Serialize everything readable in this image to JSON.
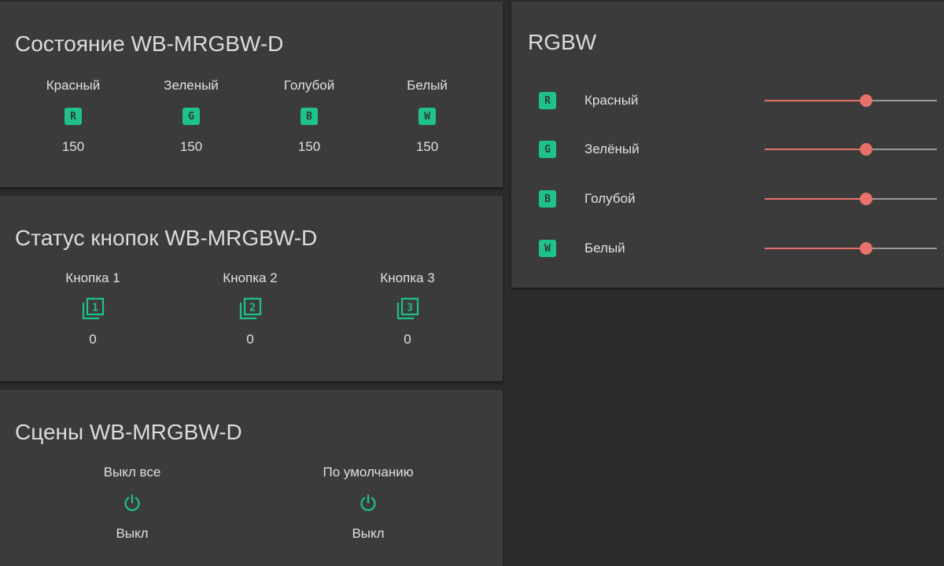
{
  "colors": {
    "background": "#2b2b2b",
    "card": "#3b3b3b",
    "accent": "#1ec28a",
    "slider": "#e8716b",
    "track": "#9a9a9a"
  },
  "state_card": {
    "title": "Состояние WB-MRGBW-D",
    "channels": [
      {
        "label": "Красный",
        "icon": "R",
        "icon_name": "red-channel-icon",
        "value": "150"
      },
      {
        "label": "Зеленый",
        "icon": "G",
        "icon_name": "green-channel-icon",
        "value": "150"
      },
      {
        "label": "Голубой",
        "icon": "B",
        "icon_name": "blue-channel-icon",
        "value": "150"
      },
      {
        "label": "Белый",
        "icon": "W",
        "icon_name": "white-channel-icon",
        "value": "150"
      }
    ]
  },
  "buttons_card": {
    "title": "Статус кнопок WB-MRGBW-D",
    "buttons": [
      {
        "label": "Кнопка 1",
        "icon": "1",
        "icon_name": "filter-1-icon",
        "value": "0"
      },
      {
        "label": "Кнопка 2",
        "icon": "2",
        "icon_name": "filter-2-icon",
        "value": "0"
      },
      {
        "label": "Кнопка 3",
        "icon": "3",
        "icon_name": "filter-3-icon",
        "value": "0"
      }
    ]
  },
  "scenes_card": {
    "title": "Сцены WB-MRGBW-D",
    "scenes": [
      {
        "label": "Выкл все",
        "icon_name": "power-icon",
        "value": "Выкл"
      },
      {
        "label": "По умолчанию",
        "icon_name": "power-icon",
        "value": "Выкл"
      }
    ]
  },
  "rgbw_card": {
    "title": "RGBW",
    "channels": [
      {
        "label": "Красный",
        "icon": "R",
        "icon_name": "red-channel-icon",
        "level": 0.59
      },
      {
        "label": "Зелёный",
        "icon": "G",
        "icon_name": "green-channel-icon",
        "level": 0.59
      },
      {
        "label": "Голубой",
        "icon": "B",
        "icon_name": "blue-channel-icon",
        "level": 0.59
      },
      {
        "label": "Белый",
        "icon": "W",
        "icon_name": "white-channel-icon",
        "level": 0.59
      }
    ]
  }
}
